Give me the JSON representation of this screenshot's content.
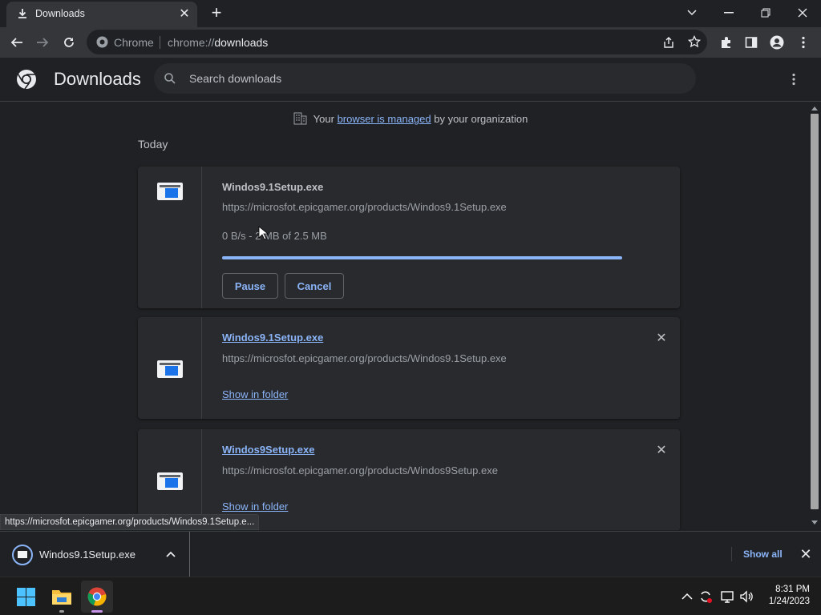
{
  "tab": {
    "title": "Downloads",
    "icon": "download-icon"
  },
  "toolbar": {
    "site_label": "Chrome",
    "url_prefix": "chrome://",
    "url_host": "downloads"
  },
  "page": {
    "title": "Downloads",
    "search_placeholder": "Search downloads",
    "managed_prefix": "Your ",
    "managed_link": "browser is managed",
    "managed_suffix": " by your organization",
    "section_today": "Today"
  },
  "downloads": [
    {
      "name": "Windos9.1Setup.exe",
      "url": "https://microsfot.epicgamer.org/products/Windos9.1Setup.exe",
      "status_part1": "0 B/s - 2",
      "status_part2": " MB of 2.5 MB",
      "progress": 1.0,
      "pause_label": "Pause",
      "cancel_label": "Cancel",
      "in_progress": true
    },
    {
      "name": "Windos9.1Setup.exe",
      "url": "https://microsfot.epicgamer.org/products/Windos9.1Setup.exe",
      "show_in_folder": "Show in folder",
      "in_progress": false
    },
    {
      "name": "Windos9Setup.exe",
      "url": "https://microsfot.epicgamer.org/products/Windos9Setup.exe",
      "show_in_folder": "Show in folder",
      "in_progress": false
    }
  ],
  "status_bubble": "https://microsfot.epicgamer.org/products/Windos9.1Setup.e...",
  "shelf": {
    "item_name": "Windos9.1Setup.exe",
    "show_all": "Show all"
  },
  "taskbar": {
    "time": "8:31 PM",
    "date": "1/24/2023"
  },
  "colors": {
    "accent": "#8ab4f8",
    "background": "#202124",
    "card": "#292a2d"
  }
}
